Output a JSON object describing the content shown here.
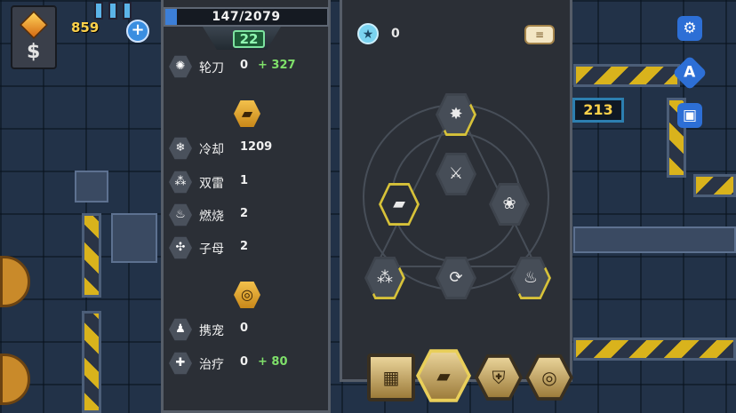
{
  "hud": {
    "gold": "859",
    "counter": "213"
  },
  "xp": {
    "current": 147,
    "max": 2079,
    "text": "147/2079"
  },
  "level": "22",
  "stats": [
    {
      "icon": "whirl-blade-icon",
      "label": "轮刀",
      "value": "0",
      "bonus": "+ 327"
    },
    {
      "icon": "cooldown-icon",
      "label": "冷却",
      "value": "1209",
      "bonus": ""
    },
    {
      "icon": "double-mine-icon",
      "label": "双雷",
      "value": "1",
      "bonus": ""
    },
    {
      "icon": "fire-icon",
      "label": "燃烧",
      "value": "2",
      "bonus": ""
    },
    {
      "icon": "cluster-icon",
      "label": "子母",
      "value": "2",
      "bonus": ""
    },
    {
      "icon": "pet-icon",
      "label": "携宠",
      "value": "0",
      "bonus": ""
    },
    {
      "icon": "heal-icon",
      "label": "治疗",
      "value": "0",
      "bonus": "+ 80"
    }
  ],
  "skill_points": "0",
  "colors": {
    "accent_gold": "#d7c239",
    "bonus_green": "#7fe06a",
    "xp_blue": "#3c7fd8",
    "panel": "#2b2f36"
  }
}
